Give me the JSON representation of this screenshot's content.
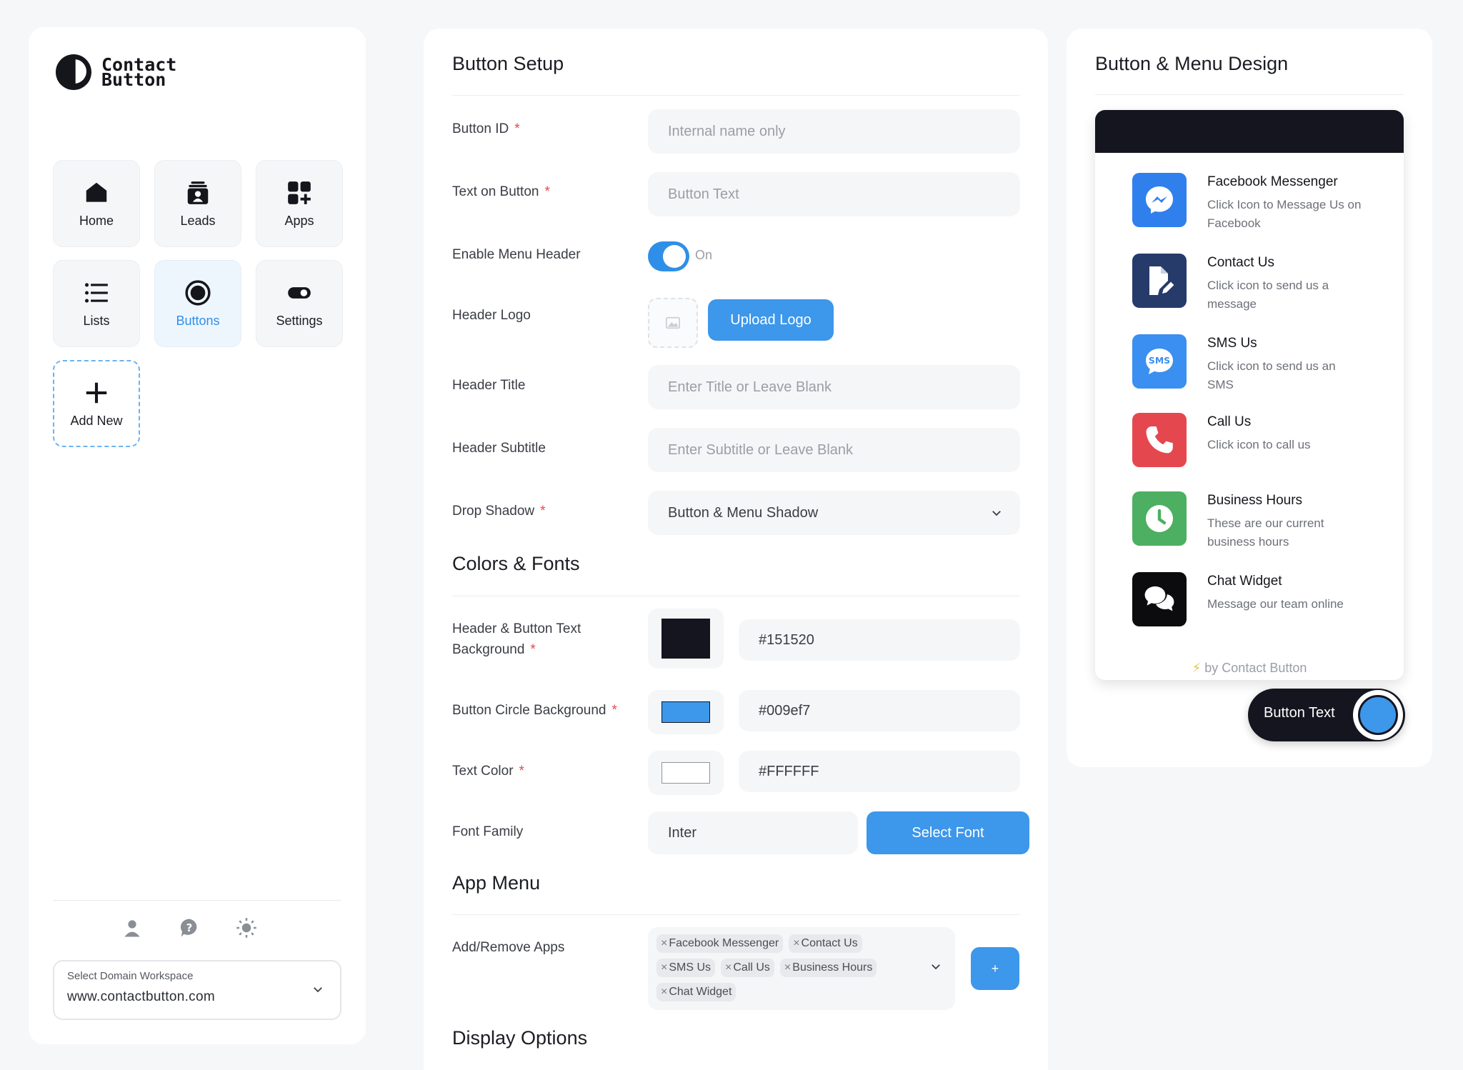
{
  "brand": {
    "line1": "Contact",
    "line2": "Button"
  },
  "nav": {
    "home": "Home",
    "leads": "Leads",
    "apps": "Apps",
    "lists": "Lists",
    "buttons": "Buttons",
    "settings": "Settings",
    "add_new": "Add New"
  },
  "workspace": {
    "label": "Select Domain Workspace",
    "value": "www.contactbutton.com"
  },
  "setup": {
    "title": "Button Setup",
    "button_id_label": "Button ID",
    "button_id_placeholder": "Internal name only",
    "text_on_button_label": "Text on Button",
    "text_on_button_placeholder": "Button Text",
    "menu_header_label": "Enable Menu Header",
    "menu_header_state": "On",
    "header_logo_label": "Header Logo",
    "upload_logo": "Upload Logo",
    "header_title_label": "Header Title",
    "header_title_placeholder": "Enter Title or Leave Blank",
    "header_subtitle_label": "Header Subtitle",
    "header_subtitle_placeholder": "Enter Subtitle or Leave Blank",
    "drop_shadow_label": "Drop Shadow",
    "drop_shadow_value": "Button & Menu Shadow"
  },
  "colors": {
    "title": "Colors & Fonts",
    "header_bg_label_1": "Header & Button Text",
    "header_bg_label_2": "Background",
    "header_bg_value": "#151520",
    "circle_bg_label": "Button Circle Background",
    "circle_bg_value": "#009ef7",
    "text_color_label": "Text Color",
    "text_color_value": "#FFFFFF",
    "font_family_label": "Font Family",
    "font_family_value": "Inter",
    "select_font": "Select Font",
    "swatch_header": "#151520",
    "swatch_circle": "#3d97ea",
    "swatch_text": "#FFFFFF"
  },
  "app_menu": {
    "title": "App Menu",
    "add_remove_label": "Add/Remove Apps",
    "tags": [
      "Facebook Messenger",
      "Contact Us",
      "SMS Us",
      "Call Us",
      "Business Hours",
      "Chat Widget"
    ],
    "add_button": "+"
  },
  "display": {
    "title": "Display Options"
  },
  "preview": {
    "title": "Button & Menu Design",
    "items": [
      {
        "title": "Facebook Messenger",
        "desc": "Click Icon to Message Us on Facebook",
        "icon": "messenger-icon",
        "color": "#2f80ed"
      },
      {
        "title": "Contact Us",
        "desc": "Click icon to send us a message",
        "icon": "contact-form-icon",
        "color": "#263b6a"
      },
      {
        "title": "SMS Us",
        "desc": "Click icon to send us an SMS",
        "icon": "sms-icon",
        "color": "#3a8ff0"
      },
      {
        "title": "Call Us",
        "desc": "Click icon to call us",
        "icon": "phone-icon",
        "color": "#e5474f"
      },
      {
        "title": "Business Hours",
        "desc": "These are our current business hours",
        "icon": "clock-icon",
        "color": "#4caf61"
      },
      {
        "title": "Chat Widget",
        "desc": "Message our team online",
        "icon": "chat-icon",
        "color": "#0c0c0e"
      }
    ],
    "powered_by": "by Contact Button",
    "button_text": "Button Text"
  }
}
